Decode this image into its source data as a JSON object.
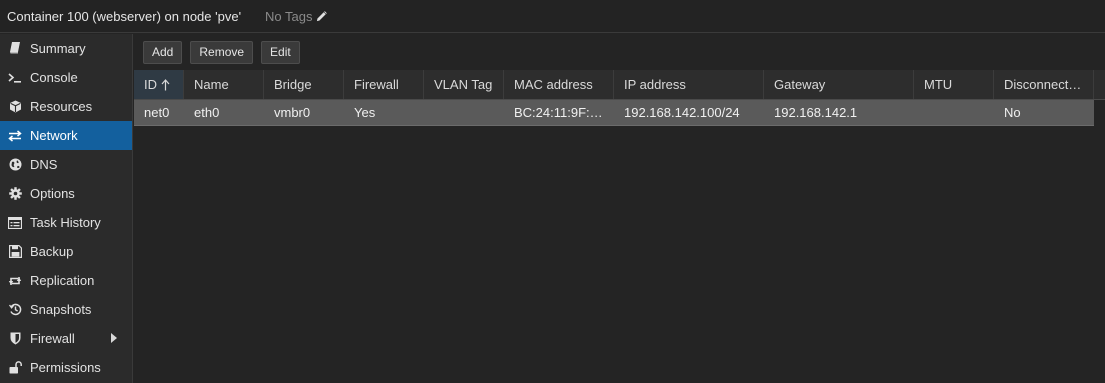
{
  "header": {
    "title": "Container 100 (webserver) on node 'pve'",
    "tags_label": "No Tags"
  },
  "sidebar": {
    "items": [
      {
        "label": "Summary",
        "icon": "book-icon"
      },
      {
        "label": "Console",
        "icon": "terminal-icon"
      },
      {
        "label": "Resources",
        "icon": "cube-icon"
      },
      {
        "label": "Network",
        "icon": "exchange-icon",
        "active": true
      },
      {
        "label": "DNS",
        "icon": "globe-icon"
      },
      {
        "label": "Options",
        "icon": "gear-icon"
      },
      {
        "label": "Task History",
        "icon": "list-icon"
      },
      {
        "label": "Backup",
        "icon": "floppy-icon"
      },
      {
        "label": "Replication",
        "icon": "retweet-icon"
      },
      {
        "label": "Snapshots",
        "icon": "history-icon"
      },
      {
        "label": "Firewall",
        "icon": "shield-icon",
        "has_submenu": true
      },
      {
        "label": "Permissions",
        "icon": "unlock-icon"
      }
    ]
  },
  "toolbar": {
    "add_label": "Add",
    "remove_label": "Remove",
    "edit_label": "Edit"
  },
  "grid": {
    "columns": [
      "ID",
      "Name",
      "Bridge",
      "Firewall",
      "VLAN Tag",
      "MAC address",
      "IP address",
      "Gateway",
      "MTU",
      "Disconnect…"
    ],
    "sorted_column": "ID",
    "sort_direction": "ascending",
    "rows": [
      [
        "net0",
        "eth0",
        "vmbr0",
        "Yes",
        "",
        "BC:24:11:9F:…",
        "192.168.142.100/24",
        "192.168.142.1",
        "",
        "No"
      ]
    ]
  },
  "colors": {
    "accent": "#13609e",
    "selected_row": "#5a5a5a",
    "background": "#242424"
  }
}
